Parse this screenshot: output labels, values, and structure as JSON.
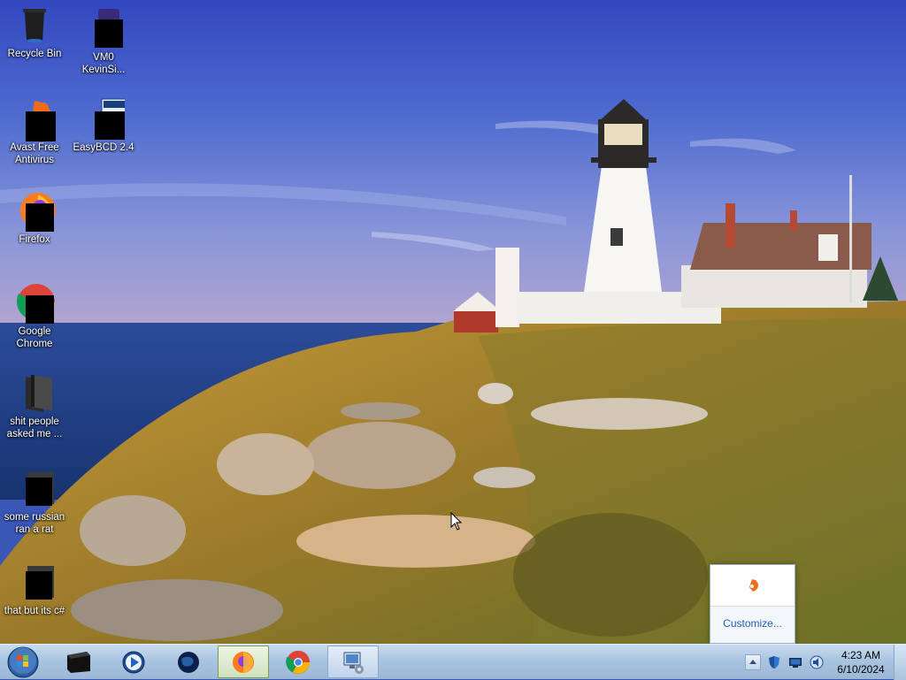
{
  "desktop": {
    "icons": [
      {
        "label": "Recycle Bin"
      },
      {
        "label": "VM0\nKevinSi..."
      },
      {
        "label": "Avast Free\nAntivirus"
      },
      {
        "label": "EasyBCD 2.4"
      },
      {
        "label": "Firefox"
      },
      {
        "label": "Google\nChrome"
      },
      {
        "label": "shit people\nasked me ..."
      },
      {
        "label": "some russian\nran a rat"
      },
      {
        "label": "that but its c#"
      }
    ]
  },
  "tray_popup": {
    "customize_label": "Customize..."
  },
  "taskbar": {
    "clock_time": "4:23 AM",
    "clock_date": "6/10/2024"
  },
  "colors": {
    "sky_top": "#3d52c2",
    "sea": "#1e3f86",
    "grass": "#9c7a2c",
    "taskbar": "#a9c4e0",
    "link": "#1e5fb4"
  }
}
